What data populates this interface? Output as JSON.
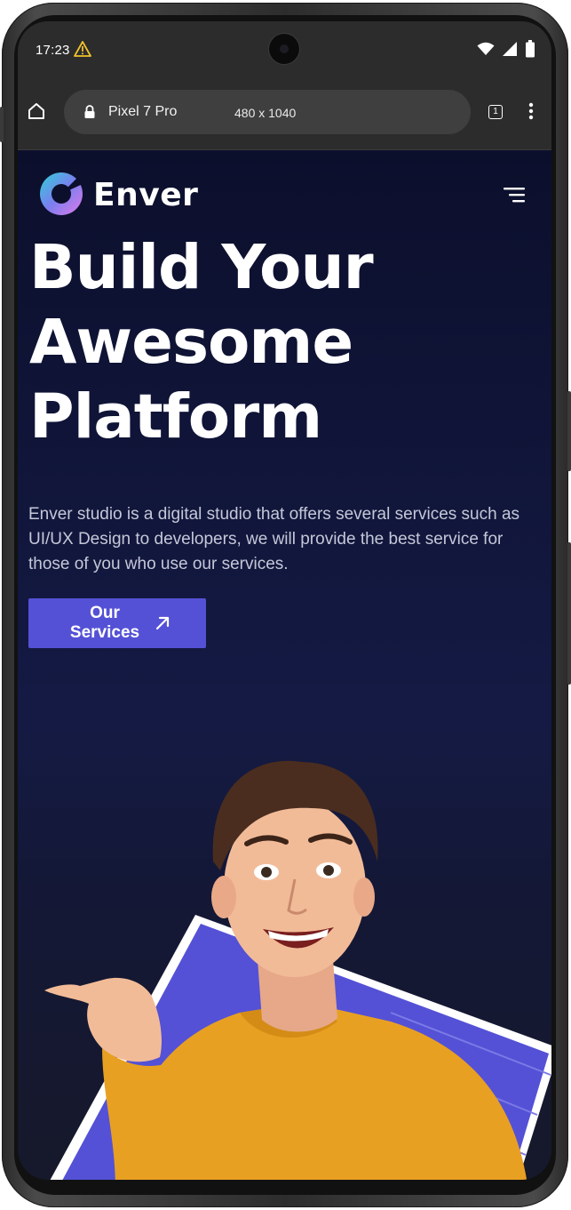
{
  "status_bar": {
    "time": "17:23",
    "icons": [
      "warning-icon",
      "wifi-icon",
      "signal-icon",
      "battery-icon"
    ]
  },
  "browser": {
    "device_name": "Pixel 7 Pro",
    "device_dims": "480 x 1040",
    "tab_count": "1",
    "icons": [
      "home-icon",
      "lock-icon",
      "tabs-icon",
      "more-vert-icon"
    ]
  },
  "site": {
    "brand": "Enver",
    "hero_title_lines": [
      "Build Your",
      "Awesome",
      "Platform"
    ],
    "description": "Enver studio is a digital studio that offers several services such as UI/UX Design to developers, we will provide the best service for those of you who use our services.",
    "cta_label": "Our Services",
    "menu_icon": "hamburger-menu-icon",
    "colors": {
      "accent": "#5451d6",
      "background": "#0c0f2c",
      "shirt": "#e8a022"
    }
  }
}
